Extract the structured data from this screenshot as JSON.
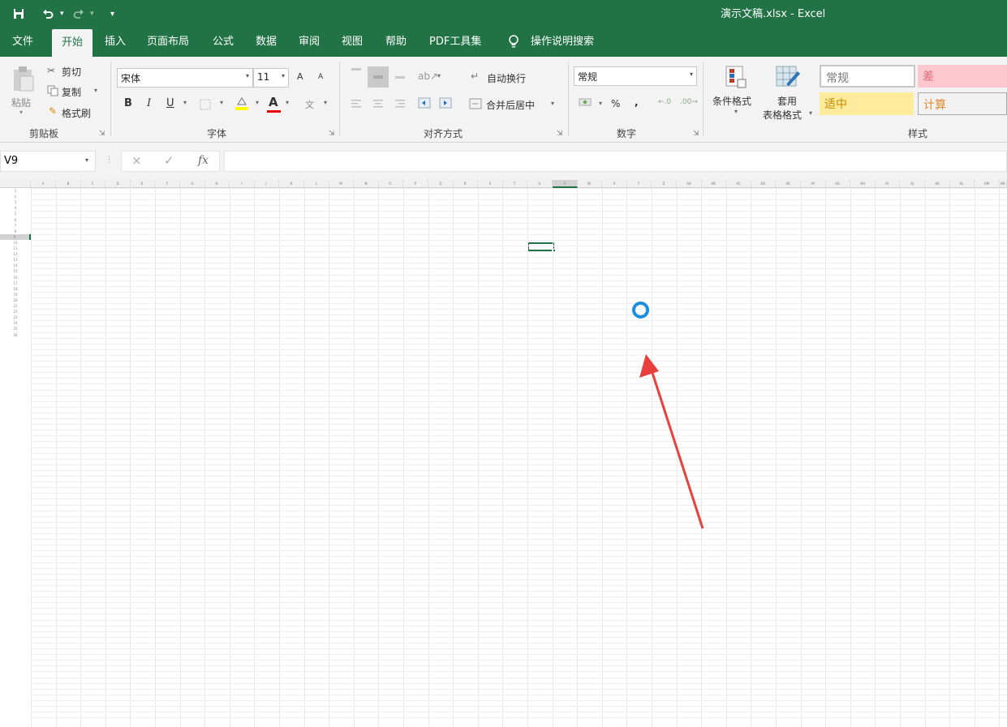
{
  "title_bar": {
    "title": "演示文稿.xlsx  -  Excel",
    "save_icon": "save-icon",
    "undo_icon": "undo-icon",
    "redo_icon": "redo-icon",
    "customize_icon": "customize-toolbar-icon"
  },
  "tabs": {
    "file": "文件",
    "home": "开始",
    "insert": "插入",
    "page_layout": "页面布局",
    "formulas": "公式",
    "data": "数据",
    "review": "审阅",
    "view": "视图",
    "help": "帮助",
    "pdf_tools": "PDF工具集",
    "tell_me": "操作说明搜索",
    "active": "开始"
  },
  "ribbon": {
    "clipboard": {
      "paste": "粘贴",
      "cut": "剪切",
      "copy": "复制",
      "format_painter": "格式刷",
      "label": "剪贴板"
    },
    "font": {
      "name": "宋体",
      "size": "11",
      "grow": "A",
      "shrink": "A",
      "bold": "B",
      "italic": "I",
      "underline": "U",
      "font_color_glyph": "A",
      "phonetic": "文",
      "label": "字体"
    },
    "alignment": {
      "wrap_text": "自动换行",
      "merge_center": "合并后居中",
      "label": "对齐方式"
    },
    "number": {
      "format": "常规",
      "percent": "%",
      "comma": ",",
      "label": "数字"
    },
    "styles": {
      "conditional_formatting": "条件格式",
      "format_as_table_1": "套用",
      "format_as_table_2": "表格格式",
      "normal": "常规",
      "bad": "差",
      "neutral": "适中",
      "calculation": "计算",
      "label": "样式"
    }
  },
  "formula_bar": {
    "name_box": "V9",
    "cancel": "×",
    "enter": "✓",
    "fx": "fx",
    "value": ""
  },
  "grid": {
    "selected_cell": "V9",
    "row_labels": [
      "1",
      "2",
      "3",
      "4",
      "5",
      "6",
      "7",
      "8",
      "9",
      "10",
      "11",
      "12",
      "13",
      "14",
      "15",
      "16",
      "17",
      "18",
      "19",
      "20",
      "21",
      "22",
      "23",
      "24",
      "25",
      "26"
    ]
  },
  "colors": {
    "accent": "#217346",
    "busy_indicator": "#1e8fde",
    "annotation_arrow": "#e8403f",
    "bad_fill": "#ffc7ce",
    "neutral_fill": "#ffeb9c"
  }
}
